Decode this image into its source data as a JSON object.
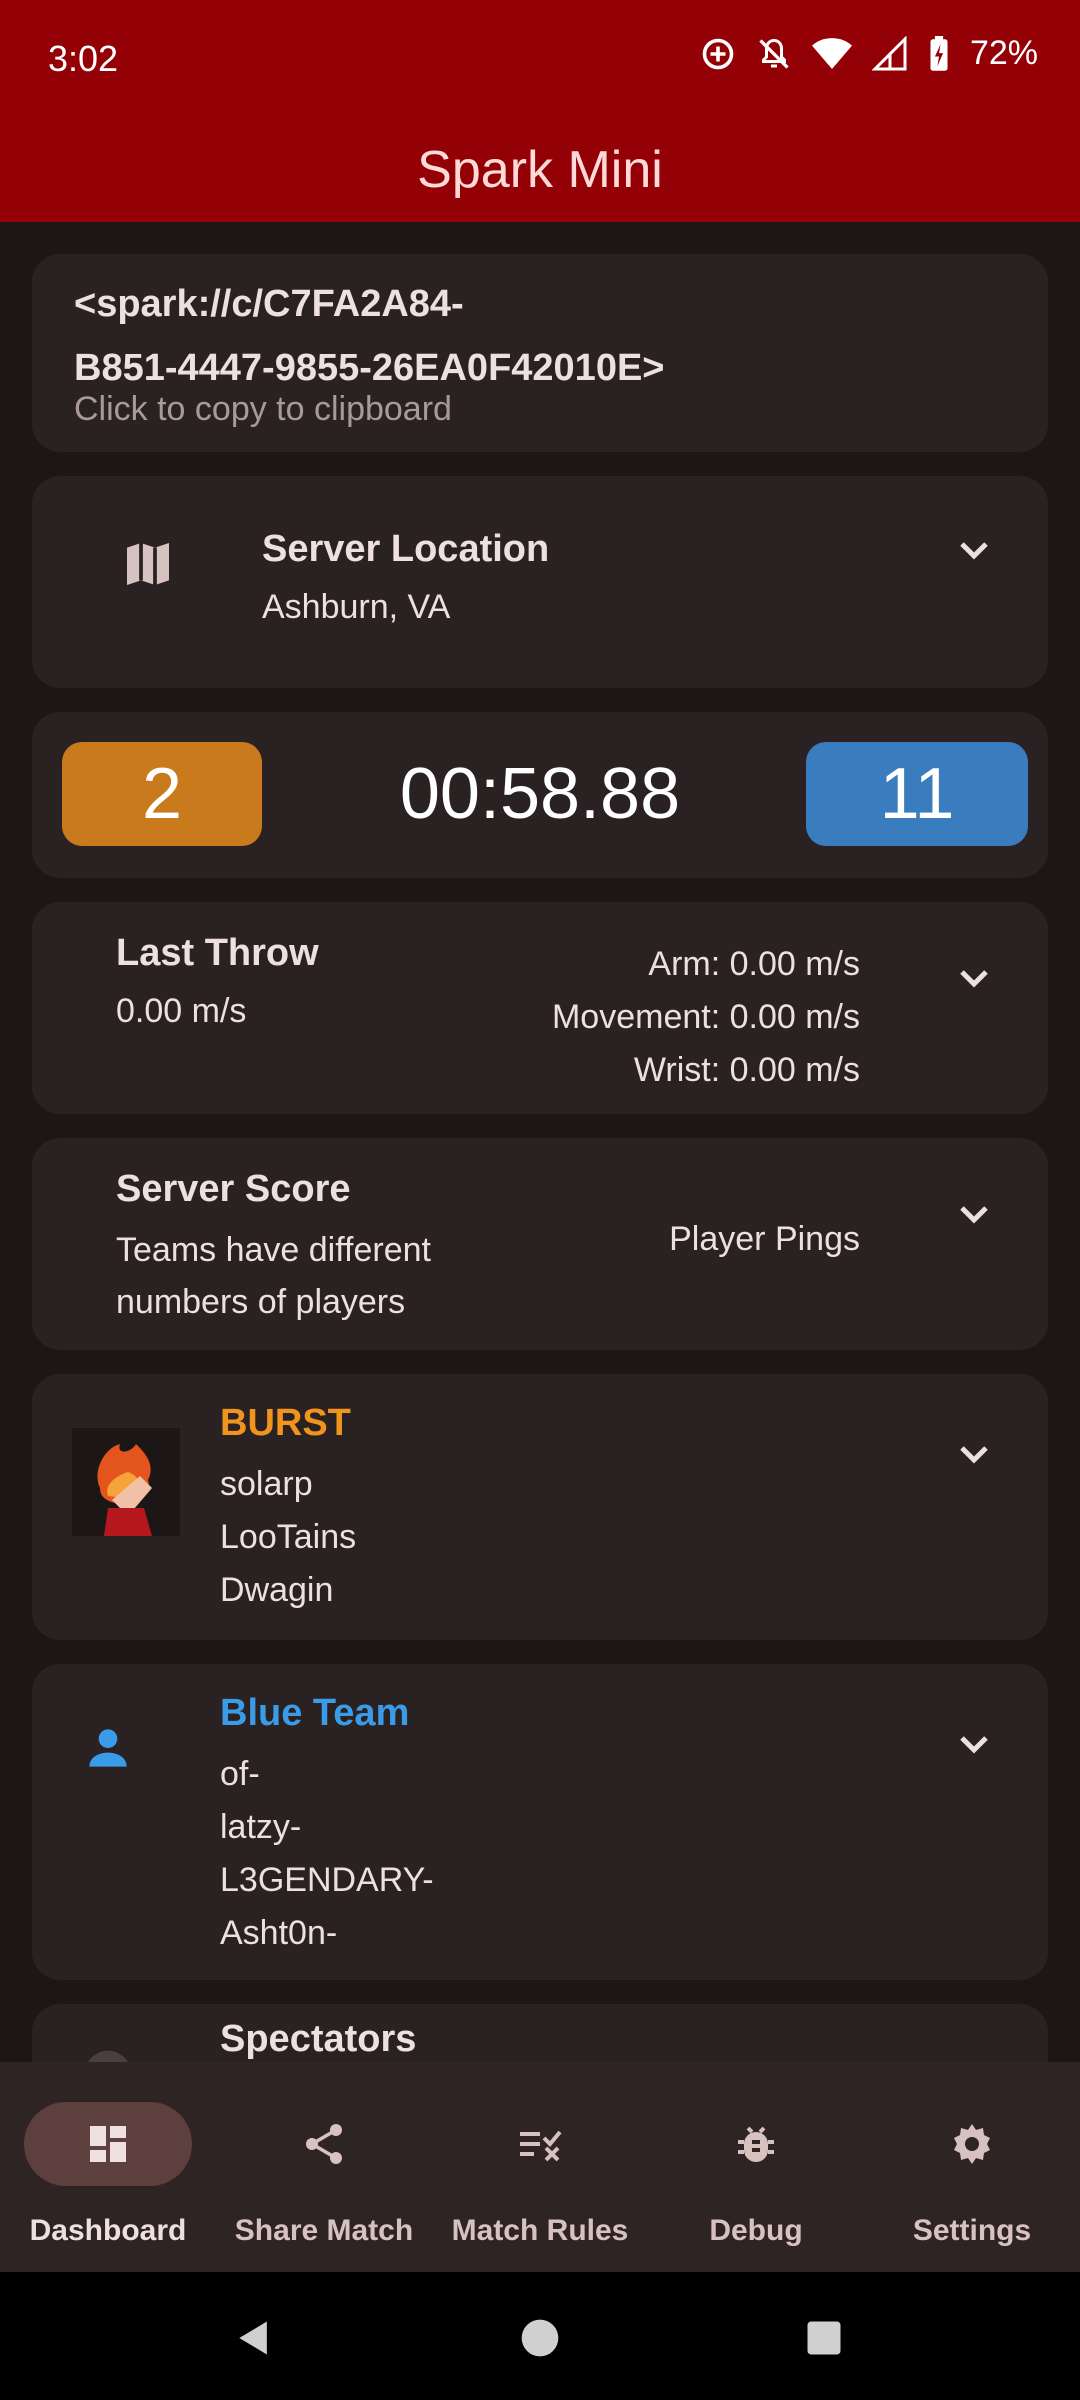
{
  "status": {
    "time": "3:02",
    "battery": "72%"
  },
  "app": {
    "title": "Spark Mini"
  },
  "link_card": {
    "link_line1": "<spark://c/C7FA2A84-",
    "link_line2": "B851-4447-9855-26EA0F42010E>",
    "hint": "Click to copy to clipboard"
  },
  "server_location": {
    "title": "Server Location",
    "value": "Ashburn, VA",
    "icon": "map-icon"
  },
  "scoreboard": {
    "orange_score": "2",
    "clock": "00:58.88",
    "blue_score": "11",
    "orange_color": "#c97a1c",
    "blue_color": "#3a7dbf"
  },
  "last_throw": {
    "title": "Last Throw",
    "value": "0.00 m/s",
    "arm": "Arm: 0.00 m/s",
    "movement": "Movement: 0.00 m/s",
    "wrist": "Wrist: 0.00 m/s"
  },
  "server_score": {
    "title": "Server Score",
    "line1": "Teams have different",
    "line2": "numbers of players",
    "pings": "Player Pings"
  },
  "orange_team": {
    "name": "BURST",
    "color": "#f0941d",
    "players": [
      "solarp",
      "LooTains",
      "Dwagin"
    ]
  },
  "blue_team": {
    "name": "Blue Team",
    "color": "#3a9be8",
    "players": [
      "of-",
      "latzy-",
      "L3GENDARY-",
      "Asht0n-"
    ],
    "icon": "person-icon"
  },
  "spectators": {
    "title": "Spectators"
  },
  "nav": {
    "items": [
      {
        "label": "Dashboard",
        "icon": "dashboard-icon"
      },
      {
        "label": "Share Match",
        "icon": "share-icon"
      },
      {
        "label": "Match Rules",
        "icon": "rules-icon"
      },
      {
        "label": "Debug",
        "icon": "bug-icon"
      },
      {
        "label": "Settings",
        "icon": "gear-icon"
      }
    ]
  }
}
